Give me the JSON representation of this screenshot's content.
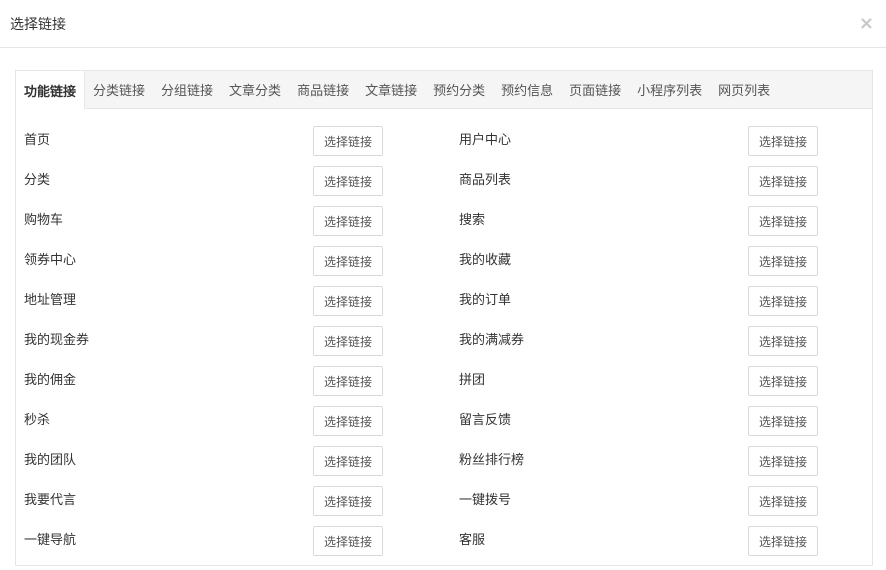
{
  "modal": {
    "title": "选择链接",
    "close_glyph": "×"
  },
  "tabs": [
    {
      "label": "功能链接",
      "active": true
    },
    {
      "label": "分类链接",
      "active": false
    },
    {
      "label": "分组链接",
      "active": false
    },
    {
      "label": "文章分类",
      "active": false
    },
    {
      "label": "商品链接",
      "active": false
    },
    {
      "label": "文章链接",
      "active": false
    },
    {
      "label": "预约分类",
      "active": false
    },
    {
      "label": "预约信息",
      "active": false
    },
    {
      "label": "页面链接",
      "active": false
    },
    {
      "label": "小程序列表",
      "active": false
    },
    {
      "label": "网页列表",
      "active": false
    }
  ],
  "select_label": "选择链接",
  "rows": [
    {
      "left": "首页",
      "right": "用户中心"
    },
    {
      "left": "分类",
      "right": "商品列表"
    },
    {
      "left": "购物车",
      "right": "搜索"
    },
    {
      "left": "领券中心",
      "right": "我的收藏"
    },
    {
      "left": "地址管理",
      "right": "我的订单"
    },
    {
      "left": "我的现金券",
      "right": "我的满减券"
    },
    {
      "left": "我的佣金",
      "right": "拼团"
    },
    {
      "left": "秒杀",
      "right": "留言反馈"
    },
    {
      "left": "我的团队",
      "right": "粉丝排行榜"
    },
    {
      "left": "我要代言",
      "right": "一键拨号"
    },
    {
      "left": "一键导航",
      "right": "客服"
    }
  ]
}
